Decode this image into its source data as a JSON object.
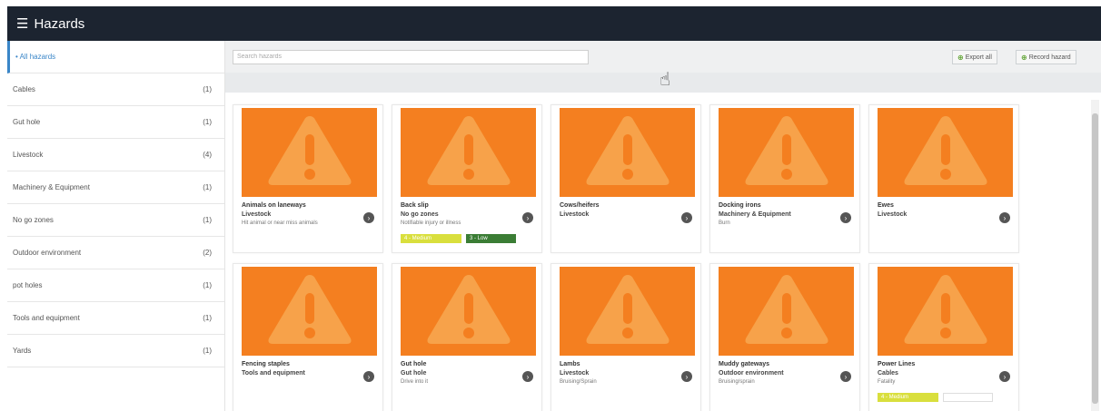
{
  "header": {
    "title": "Hazards",
    "menu_icon": "hamburger-icon"
  },
  "sidebar": {
    "items": [
      {
        "label": "All hazards",
        "count": "",
        "active": true
      },
      {
        "label": "Cables",
        "count": "(1)"
      },
      {
        "label": "Gut hole",
        "count": "(1)"
      },
      {
        "label": "Livestock",
        "count": "(4)"
      },
      {
        "label": "Machinery & Equipment",
        "count": "(1)"
      },
      {
        "label": "No go zones",
        "count": "(1)"
      },
      {
        "label": "Outdoor environment",
        "count": "(2)"
      },
      {
        "label": "pot holes",
        "count": "(1)"
      },
      {
        "label": "Tools and equipment",
        "count": "(1)"
      },
      {
        "label": "Yards",
        "count": "(1)"
      }
    ]
  },
  "toolbar": {
    "search_placeholder": "Search hazards",
    "export_label": "Export all",
    "record_label": "Record hazard"
  },
  "cards": [
    {
      "name": "Animals on laneways",
      "category": "Livestock",
      "desc": "Hit animal or near miss animals",
      "badges": []
    },
    {
      "name": "Back slip",
      "category": "No go zones",
      "desc": "Notifiable injury or illness",
      "badges": [
        {
          "text": "4 - Medium",
          "color": "yellow"
        },
        {
          "text": "3 - Low",
          "color": "green"
        }
      ]
    },
    {
      "name": "Cows/heifers",
      "category": "Livestock",
      "desc": "",
      "badges": []
    },
    {
      "name": "Docking irons",
      "category": "Machinery & Equipment",
      "desc": "Burn",
      "badges": []
    },
    {
      "name": "Ewes",
      "category": "Livestock",
      "desc": "",
      "badges": []
    },
    {
      "name": "Fencing staples",
      "category": "Tools and equipment",
      "desc": "",
      "badges": []
    },
    {
      "name": "Gut hole",
      "category": "Gut hole",
      "desc": "Drive into it",
      "badges": []
    },
    {
      "name": "Lambs",
      "category": "Livestock",
      "desc": "Bruising/Sprain",
      "badges": []
    },
    {
      "name": "Muddy gateways",
      "category": "Outdoor environment",
      "desc": "Bruising/sprain",
      "badges": []
    },
    {
      "name": "Power Lines",
      "category": "Cables",
      "desc": "Fatality",
      "badges": [
        {
          "text": "4 - Medium",
          "color": "yellow"
        },
        {
          "text": "",
          "color": "empty"
        }
      ]
    }
  ],
  "colors": {
    "header_bg": "#1c2430",
    "thumb_bg": "#f47f20",
    "accent": "#3a86c8"
  }
}
